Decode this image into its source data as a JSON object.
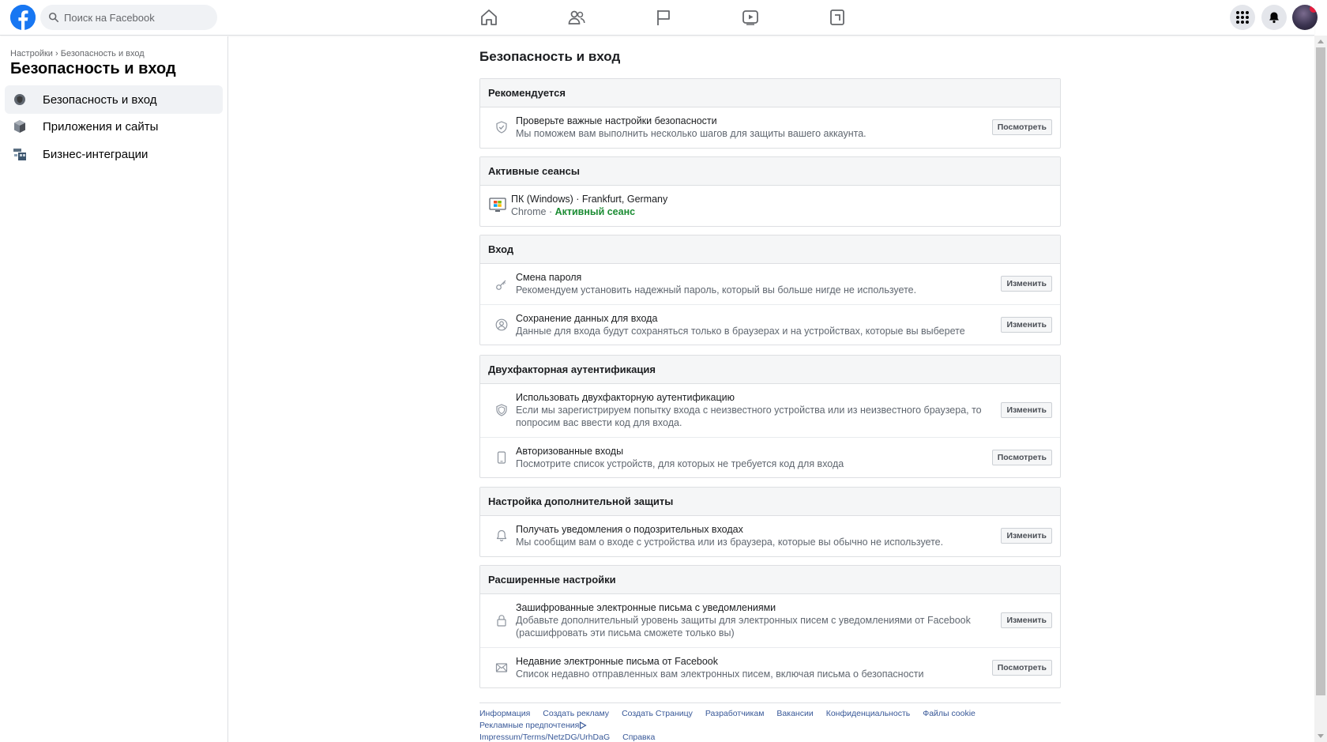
{
  "topbar": {
    "search_placeholder": "Поиск на Facebook",
    "nav_icons": [
      "home-icon",
      "friends-icon",
      "pages-flag-icon",
      "watch-video-icon",
      "gaming-icon"
    ],
    "right_icons": [
      "menu-grid-icon",
      "notifications-bell-icon",
      "profile-avatar"
    ]
  },
  "sidebar": {
    "breadcrumb_root": "Настройки",
    "breadcrumb_sep": "›",
    "breadcrumb_current": "Безопасность и вход",
    "title": "Безопасность и вход",
    "items": [
      {
        "label": "Безопасность и вход",
        "icon": "shield-icon",
        "active": true
      },
      {
        "label": "Приложения и сайты",
        "icon": "cube-icon",
        "active": false
      },
      {
        "label": "Бизнес-интеграции",
        "icon": "business-icon",
        "active": false
      }
    ]
  },
  "main": {
    "title": "Безопасность и вход",
    "recommended": {
      "header": "Рекомендуется",
      "row": {
        "title": "Проверьте важные настройки безопасности",
        "desc": "Мы поможем вам выполнить несколько шагов для защиты вашего аккаунта.",
        "button": "Посмотреть"
      }
    },
    "sessions": {
      "header": "Активные сеансы",
      "device": "ПК (Windows)",
      "sep": " · ",
      "location": "Frankfurt, Germany",
      "browser": "Chrome",
      "status": "Активный сеанс"
    },
    "login": {
      "header": "Вход",
      "rows": [
        {
          "title": "Смена пароля",
          "desc": "Рекомендуем установить надежный пароль, который вы больше нигде не используете.",
          "button": "Изменить"
        },
        {
          "title": "Сохранение данных для входа",
          "desc": "Данные для входа будут сохраняться только в браузерах и на устройствах, которые вы выберете",
          "button": "Изменить"
        }
      ]
    },
    "twofa": {
      "header": "Двухфакторная аутентификация",
      "rows": [
        {
          "title": "Использовать двухфакторную аутентификацию",
          "desc1": "Если мы зарегистрируем попытку входа с неизвестного устройства или из неизвестного браузера, то",
          "desc2": "попросим вас ввести код для входа.",
          "button": "Изменить"
        },
        {
          "title": "Авторизованные входы",
          "desc": "Посмотрите список устройств, для которых не требуется код для входа",
          "button": "Посмотреть"
        }
      ]
    },
    "extra": {
      "header": "Настройка дополнительной защиты",
      "row": {
        "title": "Получать уведомления о подозрительных входах",
        "desc": "Мы сообщим вам о входе с устройства или из браузера, которые вы обычно не используете.",
        "button": "Изменить"
      }
    },
    "advanced": {
      "header": "Расширенные настройки",
      "rows": [
        {
          "title": "Зашифрованные электронные письма с уведомлениями",
          "desc1": "Добавьте дополнительный уровень защиты для электронных писем с уведомлениями от Facebook",
          "desc2": "(расшифровать эти письма сможете только вы)",
          "button": "Изменить"
        },
        {
          "title": "Недавние электронные письма от Facebook",
          "desc": "Список недавно отправленных вам электронных писем, включая письма о безопасности",
          "button": "Посмотреть"
        }
      ]
    }
  },
  "footer": {
    "links": [
      "Информация",
      "Создать рекламу",
      "Создать Страницу",
      "Разработчикам",
      "Вакансии",
      "Конфиденциальность",
      "Файлы cookie",
      "Рекламные предпочтения"
    ],
    "links2": [
      "Impressum/Terms/NetzDG/UrhDaG",
      "Справка"
    ]
  },
  "colors": {
    "brand": "#1877f2",
    "active_green": "#1b8c33",
    "link": "#385898"
  }
}
